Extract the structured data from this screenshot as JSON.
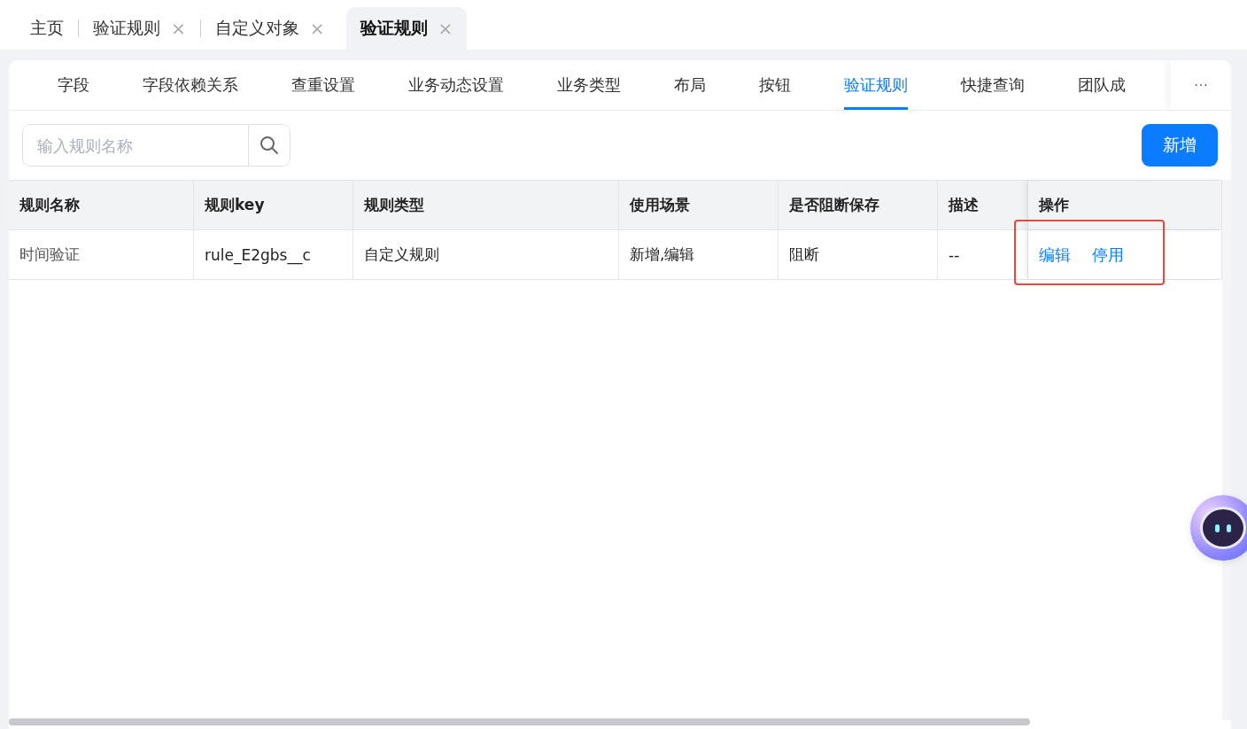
{
  "top_tabs": [
    {
      "label": "主页",
      "closable": false,
      "selected": false
    },
    {
      "label": "验证规则",
      "closable": true,
      "selected": false
    },
    {
      "label": "自定义对象",
      "closable": true,
      "selected": false
    },
    {
      "label": "验证规则",
      "closable": true,
      "selected": true
    }
  ],
  "close_glyph": "×",
  "sub_tabs": [
    {
      "label": "字段",
      "selected": false
    },
    {
      "label": "字段依赖关系",
      "selected": false
    },
    {
      "label": "查重设置",
      "selected": false
    },
    {
      "label": "业务动态设置",
      "selected": false
    },
    {
      "label": "业务类型",
      "selected": false
    },
    {
      "label": "布局",
      "selected": false
    },
    {
      "label": "按钮",
      "selected": false
    },
    {
      "label": "验证规则",
      "selected": true
    },
    {
      "label": "快捷查询",
      "selected": false
    },
    {
      "label": "团队成",
      "selected": false
    }
  ],
  "more_button": {
    "label": "···"
  },
  "search": {
    "placeholder": "输入规则名称"
  },
  "add_button": {
    "label": "新增"
  },
  "table": {
    "columns": [
      "规则名称",
      "规则key",
      "规则类型",
      "使用场景",
      "是否阻断保存",
      "描述",
      "操作"
    ],
    "rows": [
      {
        "cells": [
          "时间验证",
          "rule_E2gbs__c",
          "自定义规则",
          "新增,编辑",
          "阻断",
          "--"
        ],
        "actions": [
          "编辑",
          "停用"
        ],
        "highlighted": true
      }
    ]
  }
}
